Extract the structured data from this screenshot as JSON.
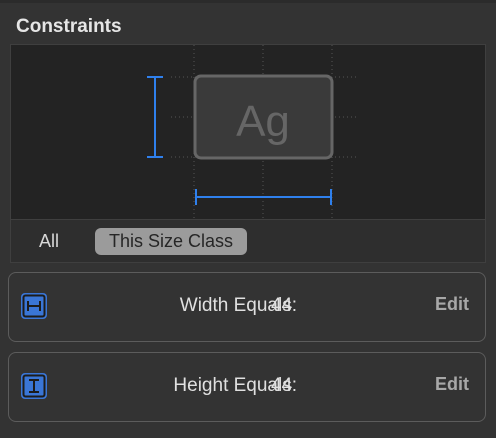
{
  "panel": {
    "title": "Constraints"
  },
  "preview": {
    "sample_text": "Ag"
  },
  "size_class": {
    "options": [
      "All",
      "This Size Class"
    ],
    "selected": "This Size Class"
  },
  "constraints": [
    {
      "label": "Width Equals:",
      "value": "44",
      "action": "Edit",
      "icon": "width-constraint-icon"
    },
    {
      "label": "Height Equals:",
      "value": "44",
      "action": "Edit",
      "icon": "height-constraint-icon"
    }
  ],
  "colors": {
    "accent": "#3a76d6",
    "background": "#333333",
    "preview_background": "#232323",
    "selected_segment": "#9b9b9b"
  }
}
